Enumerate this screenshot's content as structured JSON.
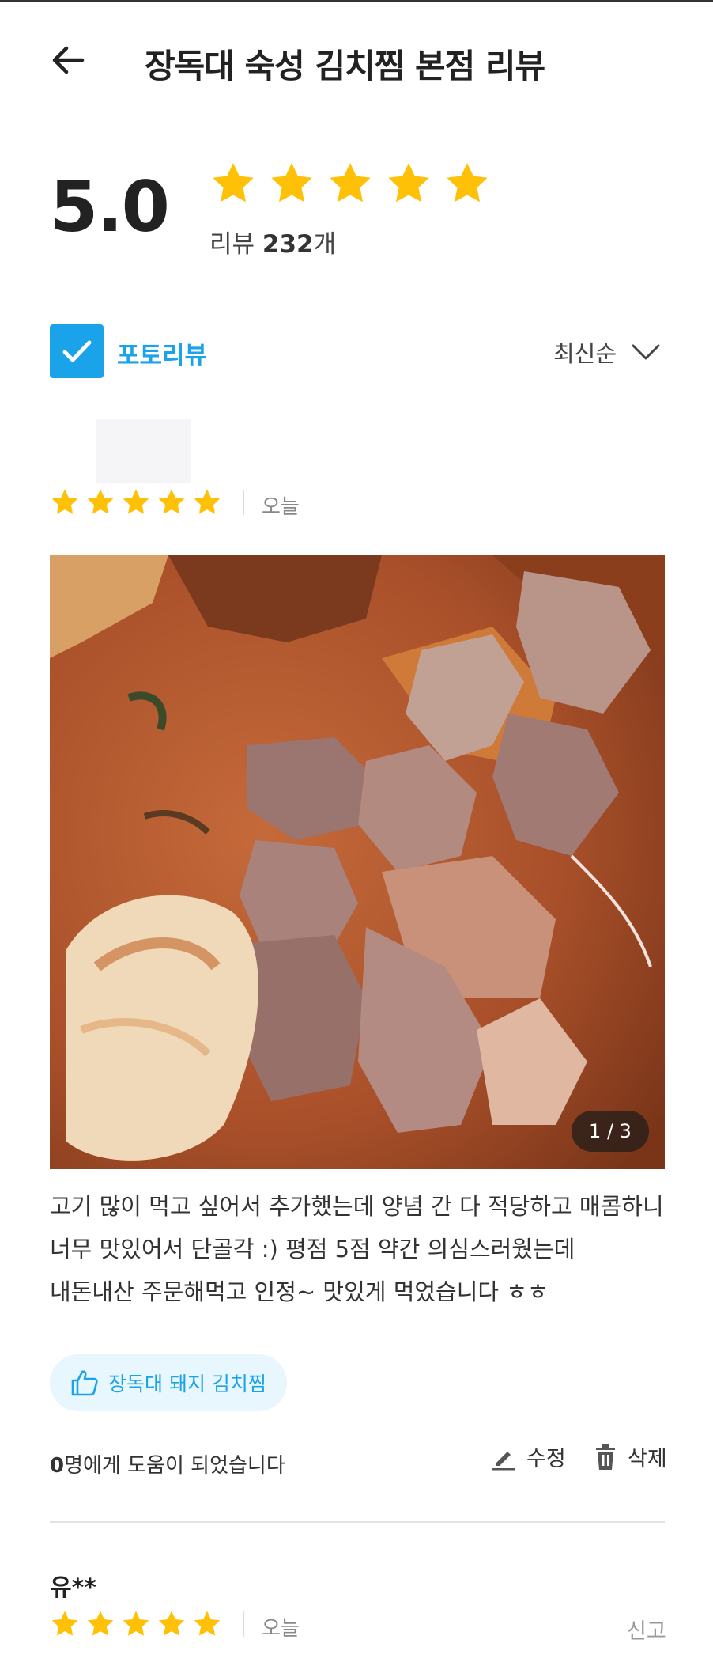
{
  "header": {
    "title": "장독대 숙성 김치찜 본점 리뷰"
  },
  "summary": {
    "average": "5.0",
    "star_count": 5,
    "count_prefix": "리뷰 ",
    "count_value": "232",
    "count_suffix": "개"
  },
  "filters": {
    "photo_review_label": "포토리뷰",
    "photo_review_checked": true,
    "sort_label": "최신순"
  },
  "reviews": [
    {
      "rating": 5,
      "date": "오늘",
      "photo_counter": "1 / 3",
      "text": "고기 많이 먹고 싶어서 추가했는데 양념 간 다 적당하고 매콤하니 너무 맛있어서 단골각 :) 평점 5점 약간 의심스러웠는데 내돈내산 주문해먹고 인정~ 맛있게 먹었습니다 ㅎㅎ",
      "menu_tag": "장독대 돼지 김치찜",
      "helpful_count": "0",
      "helpful_suffix": "명에게 도움이 되었습니다",
      "edit_label": "수정",
      "delete_label": "삭제"
    },
    {
      "name": "유**",
      "rating": 5,
      "date": "오늘",
      "report_label": "신고"
    }
  ],
  "colors": {
    "star": "#FFC107",
    "accent": "#1AA3E8",
    "chip_bg": "#E8F6FD"
  }
}
